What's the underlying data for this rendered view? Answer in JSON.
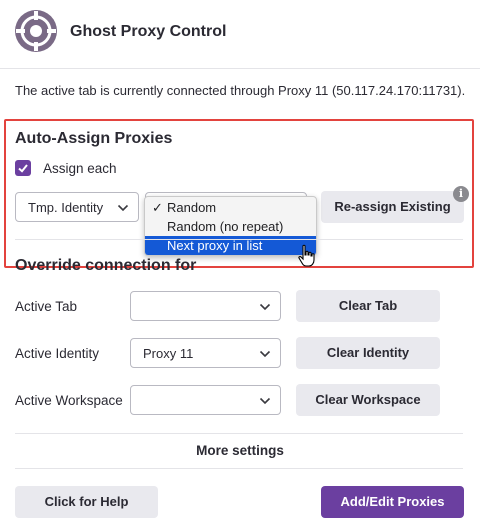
{
  "header": {
    "title": "Ghost Proxy Control",
    "logo_icon": "ghost-logo-icon"
  },
  "status": {
    "text": "The active tab is currently connected through Proxy 11 (50.117.24.170:11731)."
  },
  "auto_assign": {
    "title": "Auto-Assign Proxies",
    "checkbox_label": "Assign each",
    "checkbox_checked": true,
    "scope_select": "Tmp. Identity",
    "mode_options": [
      "Random",
      "Random (no repeat)",
      "Next proxy in list"
    ],
    "mode_checked": "Random",
    "mode_highlighted": "Next proxy in list",
    "reassign_button": "Re-assign Existing",
    "info_icon_glyph": "i"
  },
  "override": {
    "title": "Override connection for",
    "rows": [
      {
        "label": "Active Tab",
        "value": "",
        "button": "Clear Tab"
      },
      {
        "label": "Active Identity",
        "value": "Proxy 11",
        "button": "Clear Identity"
      },
      {
        "label": "Active Workspace",
        "value": "",
        "button": "Clear Workspace"
      }
    ]
  },
  "footer": {
    "more_settings": "More settings",
    "help_button": "Click for Help",
    "add_edit_button": "Add/Edit Proxies"
  },
  "colors": {
    "accent": "#6b3fa0",
    "highlight_box": "#e3433e",
    "menu_selection": "#1459d6"
  }
}
